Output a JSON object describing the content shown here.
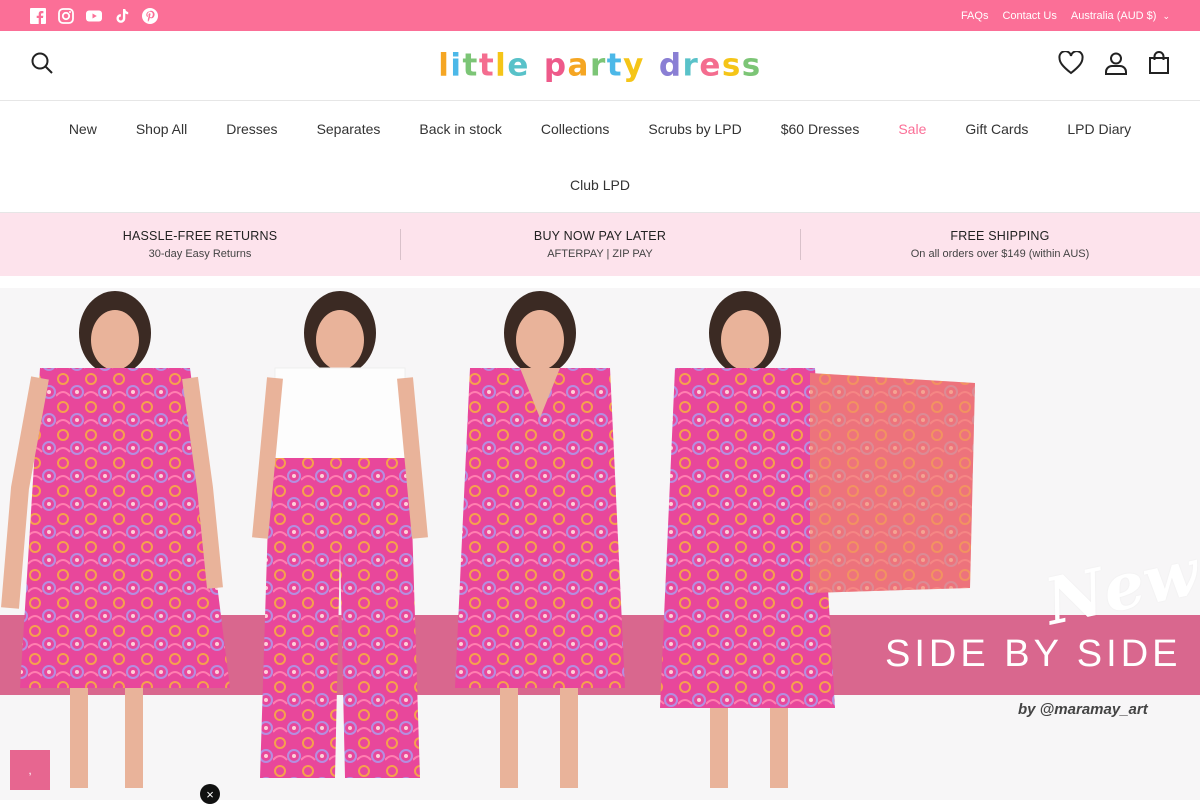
{
  "topbar": {
    "social_icons": [
      "facebook-icon",
      "instagram-icon",
      "youtube-icon",
      "tiktok-icon",
      "pinterest-icon"
    ],
    "links": [
      "FAQs",
      "Contact Us"
    ],
    "region": "Australia (AUD $)",
    "bg_color": "#fb6f97"
  },
  "header": {
    "logo": {
      "words": [
        {
          "letters": [
            {
              "ch": "l",
              "color": "#f5a623"
            },
            {
              "ch": "i",
              "color": "#4cb8e8"
            },
            {
              "ch": "t",
              "color": "#7cc576"
            },
            {
              "ch": "t",
              "color": "#f46d8f"
            },
            {
              "ch": "l",
              "color": "#f5c518"
            },
            {
              "ch": "e",
              "color": "#59c2c9"
            }
          ]
        },
        {
          "letters": [
            {
              "ch": "p",
              "color": "#ee5a8a"
            },
            {
              "ch": "a",
              "color": "#f5a623"
            },
            {
              "ch": "r",
              "color": "#7cc576"
            },
            {
              "ch": "t",
              "color": "#4cb8e8"
            },
            {
              "ch": "y",
              "color": "#f5c518"
            }
          ]
        },
        {
          "letters": [
            {
              "ch": "d",
              "color": "#8a7fd4"
            },
            {
              "ch": "r",
              "color": "#59c2c9"
            },
            {
              "ch": "e",
              "color": "#f46d8f"
            },
            {
              "ch": "s",
              "color": "#f5c518"
            },
            {
              "ch": "s",
              "color": "#7cc576"
            }
          ]
        }
      ]
    },
    "icons": [
      "search-icon",
      "heart-icon",
      "account-icon",
      "cart-icon"
    ]
  },
  "nav": {
    "row1": [
      {
        "label": "New"
      },
      {
        "label": "Shop All"
      },
      {
        "label": "Dresses"
      },
      {
        "label": "Separates"
      },
      {
        "label": "Back in stock"
      },
      {
        "label": "Collections"
      },
      {
        "label": "Scrubs by LPD"
      },
      {
        "label": "$60 Dresses"
      },
      {
        "label": "Sale",
        "highlight": true
      },
      {
        "label": "Gift Cards"
      },
      {
        "label": "LPD Diary"
      }
    ],
    "row2": [
      {
        "label": "Club LPD"
      }
    ],
    "highlight_color": "#fb6f97"
  },
  "usp": [
    {
      "title": "HASSLE-FREE RETURNS",
      "subtitle": "30-day Easy Returns"
    },
    {
      "title": "BUY NOW PAY LATER",
      "subtitle": "AFTERPAY | ZIP PAY"
    },
    {
      "title": "FREE SHIPPING",
      "subtitle": "On all orders over $149 (within AUS)"
    }
  ],
  "hero": {
    "script": "New",
    "title": "SIDE BY SIDE",
    "subtitle": "by @maramay_art",
    "band_color": "#d9678e"
  },
  "floating": {
    "badge_text": ",",
    "close_symbol": "×"
  }
}
